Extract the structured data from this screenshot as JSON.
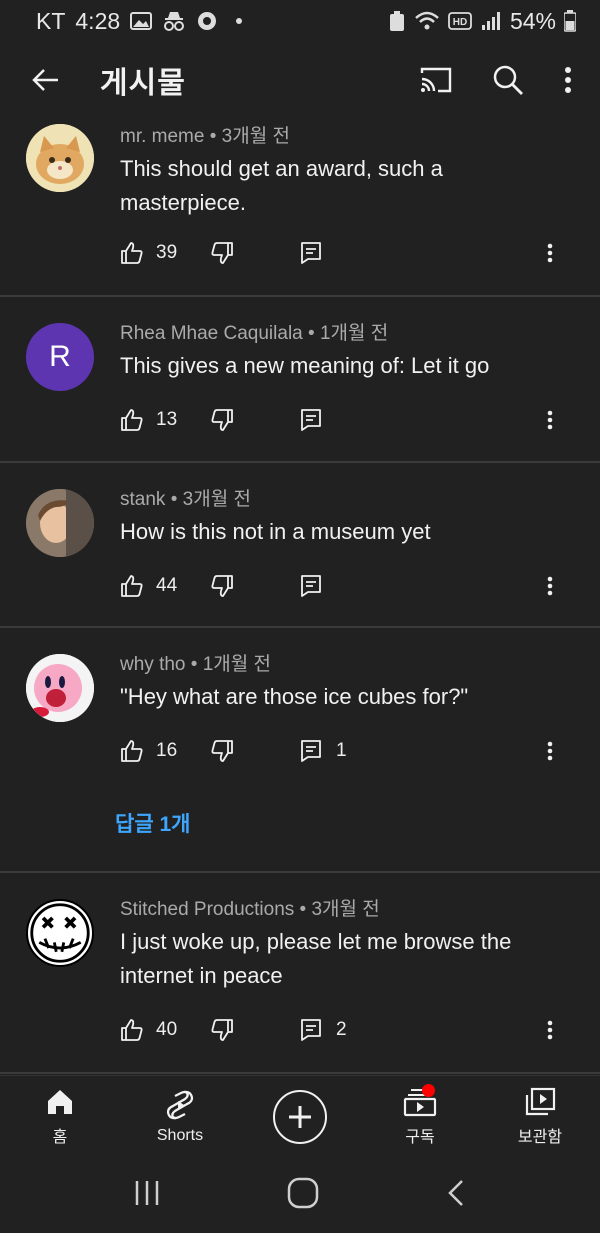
{
  "status": {
    "carrier": "KT",
    "time": "4:28",
    "battery": "54%"
  },
  "appbar": {
    "title": "게시물"
  },
  "comments": [
    {
      "author": "mr. meme",
      "time": "3개월 전",
      "text": "This should get an award, such a masterpiece.",
      "likes": "39",
      "replies": ""
    },
    {
      "author": "Rhea Mhae Caquilala",
      "time": "1개월 전",
      "text": "This gives a new meaning of: Let it go",
      "likes": "13",
      "replies": "",
      "avatar_letter": "R"
    },
    {
      "author": "stank",
      "time": "3개월 전",
      "text": "How is this not in a museum yet",
      "likes": "44",
      "replies": ""
    },
    {
      "author": "why tho",
      "time": "1개월 전",
      "text": "\"Hey what are those ice cubes for?\"",
      "likes": "16",
      "replies": "1",
      "replies_link": "답글 1개"
    },
    {
      "author": "Stitched Productions",
      "time": "3개월 전",
      "text": "I just woke up, please let me browse the internet in peace",
      "likes": "40",
      "replies": "2"
    }
  ],
  "nav": {
    "home": "홈",
    "shorts": "Shorts",
    "subscriptions": "구독",
    "library": "보관함"
  },
  "colors": {
    "background": "#212121",
    "link": "#3ea6ff",
    "avatar_purple": "#5e35b1",
    "notification": "#ff0000"
  },
  "icons": [
    "back-arrow-icon",
    "cast-icon",
    "search-icon",
    "more-vert-icon",
    "thumb-up-icon",
    "thumb-down-icon",
    "reply-icon",
    "home-icon",
    "shorts-icon",
    "create-icon",
    "subscriptions-icon",
    "library-icon"
  ]
}
